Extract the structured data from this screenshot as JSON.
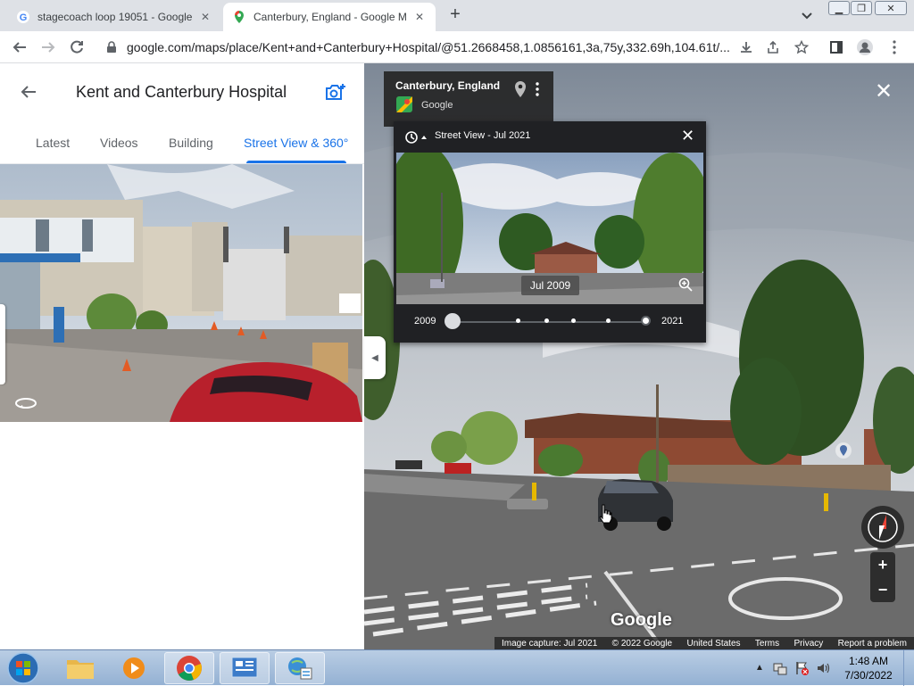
{
  "browser": {
    "tabs": [
      {
        "title": "stagecoach loop 19051 - Google",
        "active": false
      },
      {
        "title": "Canterbury, England - Google M",
        "active": true
      }
    ],
    "new_tab_label": "+",
    "url": "google.com/maps/place/Kent+and+Canterbury+Hospital/@51.2668458,1.0856161,3a,75y,332.69h,104.61t/..."
  },
  "left_panel": {
    "title": "Kent and Canterbury Hospital",
    "tabs": [
      "Latest",
      "Videos",
      "Building",
      "Street View & 360°"
    ],
    "active_tab": "Street View & 360°"
  },
  "street_view": {
    "location_title": "Canterbury, England",
    "location_subtitle": "Google",
    "time_machine": {
      "title": "Street View - Jul 2021",
      "preview_date": "Jul 2009",
      "start_year": "2009",
      "end_year": "2021",
      "selected_position": 0.0
    },
    "watermark": "Google",
    "footer": {
      "capture": "Image capture: Jul 2021",
      "copyright": "© 2022 Google",
      "country": "United States",
      "terms": "Terms",
      "privacy": "Privacy",
      "report": "Report a problem"
    },
    "zoom_in": "+",
    "zoom_out": "−"
  },
  "taskbar": {
    "time": "1:48 AM",
    "date": "7/30/2022"
  }
}
